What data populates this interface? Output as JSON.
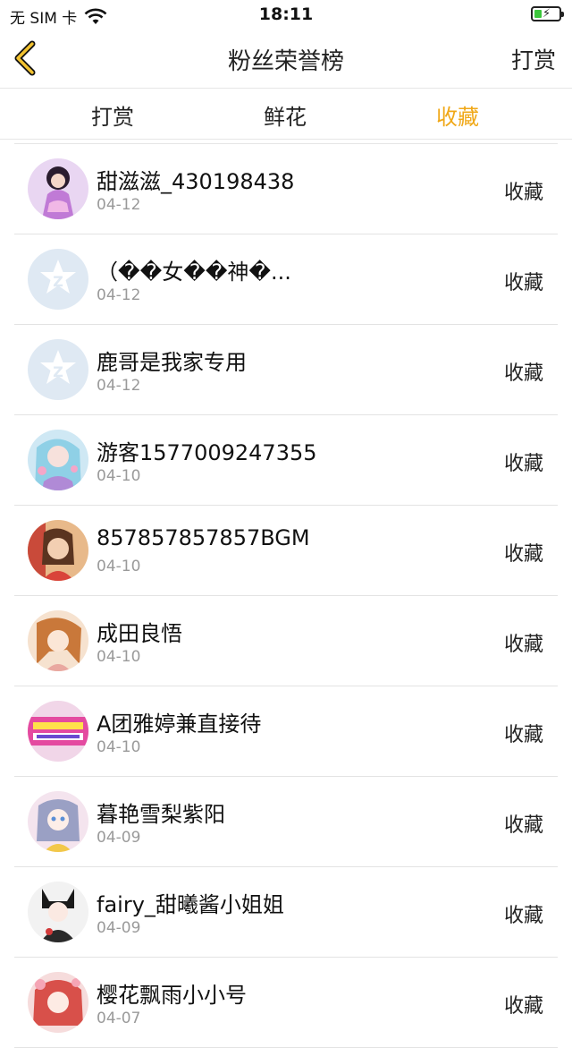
{
  "status": {
    "carrier": "无 SIM 卡",
    "time": "18:11"
  },
  "nav": {
    "title": "粉丝荣誉榜",
    "right_label": "打赏"
  },
  "tabs": [
    {
      "label": "打赏",
      "active": false
    },
    {
      "label": "鲜花",
      "active": false
    },
    {
      "label": "收藏",
      "active": true
    }
  ],
  "colors": {
    "accent": "#f0a818",
    "divider": "#e6e6e6",
    "date": "#9a9a9a"
  },
  "rows": [
    {
      "name": "甜滋滋_430198438",
      "date": "04-12",
      "action": "收藏",
      "avatar": "photo-girl-purple"
    },
    {
      "name": "（��女��神�...",
      "date": "04-12",
      "action": "收藏",
      "avatar": "default-qq-avatar"
    },
    {
      "name": "鹿哥是我家专用",
      "date": "04-12",
      "action": "收藏",
      "avatar": "default-qq-avatar"
    },
    {
      "name": "游客1577009247355",
      "date": "04-10",
      "action": "收藏",
      "avatar": "anime-blue"
    },
    {
      "name": "857857857857BGM",
      "date": "04-10",
      "action": "收藏",
      "avatar": "photo-woman"
    },
    {
      "name": "成田良悟",
      "date": "04-10",
      "action": "收藏",
      "avatar": "anime-orange"
    },
    {
      "name": "A团雅婷兼直接待",
      "date": "04-10",
      "action": "收藏",
      "avatar": "text-banner"
    },
    {
      "name": "暮艳雪梨紫阳",
      "date": "04-09",
      "action": "收藏",
      "avatar": "anime-pink"
    },
    {
      "name": "fairy_甜曦酱小姐姐",
      "date": "04-09",
      "action": "收藏",
      "avatar": "anime-dark"
    },
    {
      "name": "樱花飘雨小小号",
      "date": "04-07",
      "action": "收藏",
      "avatar": "anime-red"
    }
  ]
}
